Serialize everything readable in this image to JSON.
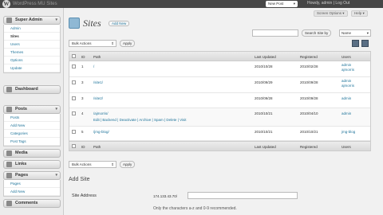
{
  "topbar": {
    "site_name": "WordPress MU Sites",
    "new_post": "New Post",
    "howdy": "Howdy, admin | Log Out"
  },
  "screen_options_label": "Screen Options ▾",
  "help_label": "Help ▾",
  "sidebar": {
    "super_admin": {
      "label": "Super Admin",
      "items": [
        "Admin",
        "Sites",
        "Users",
        "Themes",
        "Options",
        "Update"
      ]
    },
    "dashboard": "Dashboard",
    "posts": {
      "label": "Posts",
      "items": [
        "Posts",
        "Add New",
        "Categories",
        "Post Tags"
      ]
    },
    "media": "Media",
    "links": "Links",
    "pages": {
      "label": "Pages",
      "items": [
        "Pages",
        "Add New"
      ]
    },
    "comments": "Comments"
  },
  "page": {
    "title": "Sites",
    "add_new": "Add New"
  },
  "search": {
    "button": "Search Site by",
    "by": "Name"
  },
  "bulk": {
    "label": "Bulk Actions",
    "apply": "Apply"
  },
  "table": {
    "columns": [
      "ID",
      "Path",
      "Last Updated",
      "Registered",
      "Users"
    ],
    "rows": [
      {
        "id": "1",
        "path": "/",
        "updated": "2010/10/28",
        "registered": "2010/02/28",
        "users": [
          "admin",
          "ajmorris"
        ]
      },
      {
        "id": "3",
        "path": "/site1/",
        "updated": "2010/09/29",
        "registered": "2010/09/28",
        "users": [
          "admin",
          "ajmorris"
        ]
      },
      {
        "id": "3",
        "path": "/site2/",
        "updated": "2010/09/28",
        "registered": "2010/09/28",
        "users": [
          "admin"
        ]
      },
      {
        "id": "4",
        "path": "/ajmorris/",
        "updated": "2010/10/21",
        "registered": "2010/04/10",
        "users": [
          "admin"
        ],
        "actions": "Edit | Backend | Deactivate | Archive | Spam | Delete | Visit"
      },
      {
        "id": "5",
        "path": "/jmg-blog/",
        "updated": "2010/10/21",
        "registered": "2010/10/21",
        "users": [
          "jmg-blog"
        ]
      }
    ]
  },
  "add_site": {
    "title": "Add Site",
    "address_label": "Site Address",
    "address_prefix": "174.133.43.70/",
    "address_help": "Only the characters a-z and 0-9 recommended."
  }
}
